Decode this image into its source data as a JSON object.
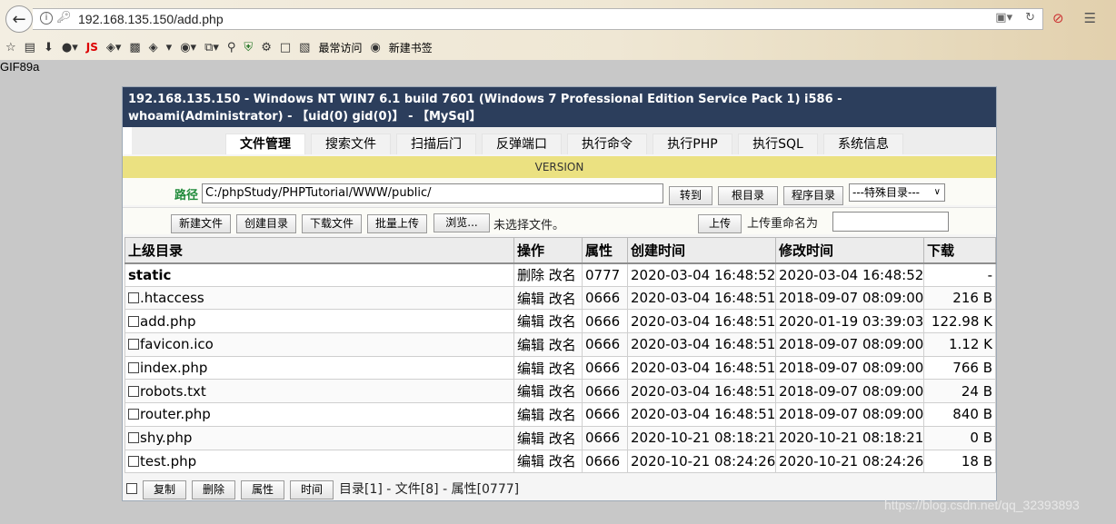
{
  "browser": {
    "url": "192.168.135.150/add.php",
    "bookmarks": {
      "js_label": "JS",
      "most_visited": "最常访问",
      "new_bookmark": "新建书签"
    }
  },
  "page_top_text": "GIF89a",
  "shell": {
    "header_text": "192.168.135.150 - Windows NT WIN7 6.1 build 7601 (Windows 7 Professional Edition Service Pack 1) i586 - whoami(Administrator) - 【uid(0) gid(0)】 - 【MySql】",
    "tabs": [
      {
        "label": "文件管理",
        "active": true
      },
      {
        "label": "搜索文件",
        "active": false
      },
      {
        "label": "扫描后门",
        "active": false
      },
      {
        "label": "反弹端口",
        "active": false
      },
      {
        "label": "执行命令",
        "active": false
      },
      {
        "label": "执行PHP",
        "active": false
      },
      {
        "label": "执行SQL",
        "active": false
      },
      {
        "label": "系统信息",
        "active": false
      }
    ],
    "version": "VERSION",
    "path": {
      "label": "路径",
      "value": "C:/phpStudy/PHPTutorial/WWW/public/",
      "goto_button": "转到",
      "root_button": "根目录",
      "program_button": "程序目录",
      "special_select": "---特殊目录---"
    },
    "upload": {
      "new_file": "新建文件",
      "create_dir": "创建目录",
      "download_file": "下载文件",
      "batch_upload": "批量上传",
      "browse": "浏览...",
      "no_file": "未选择文件。",
      "upload_button": "上传",
      "rename_label": "上传重命名为",
      "rename_value": ""
    },
    "table": {
      "columns": [
        "上级目录",
        "操作",
        "属性",
        "创建时间",
        "修改时间",
        "下载"
      ],
      "rows": [
        {
          "name": "static",
          "ops": "删除 改名",
          "attr": "0777",
          "created": "2020-03-04 16:48:52",
          "modified": "2020-03-04 16:48:52",
          "size": "-",
          "is_dir": true
        },
        {
          "name": ".htaccess",
          "ops": "编辑 改名",
          "attr": "0666",
          "created": "2020-03-04 16:48:51",
          "modified": "2018-09-07 08:09:00",
          "size": "216 B",
          "is_dir": false
        },
        {
          "name": "add.php",
          "ops": "编辑 改名",
          "attr": "0666",
          "created": "2020-03-04 16:48:51",
          "modified": "2020-01-19 03:39:03",
          "size": "122.98 K",
          "is_dir": false
        },
        {
          "name": "favicon.ico",
          "ops": "编辑 改名",
          "attr": "0666",
          "created": "2020-03-04 16:48:51",
          "modified": "2018-09-07 08:09:00",
          "size": "1.12 K",
          "is_dir": false
        },
        {
          "name": "index.php",
          "ops": "编辑 改名",
          "attr": "0666",
          "created": "2020-03-04 16:48:51",
          "modified": "2018-09-07 08:09:00",
          "size": "766 B",
          "is_dir": false
        },
        {
          "name": "robots.txt",
          "ops": "编辑 改名",
          "attr": "0666",
          "created": "2020-03-04 16:48:51",
          "modified": "2018-09-07 08:09:00",
          "size": "24 B",
          "is_dir": false
        },
        {
          "name": "router.php",
          "ops": "编辑 改名",
          "attr": "0666",
          "created": "2020-03-04 16:48:51",
          "modified": "2018-09-07 08:09:00",
          "size": "840 B",
          "is_dir": false
        },
        {
          "name": "shy.php",
          "ops": "编辑 改名",
          "attr": "0666",
          "created": "2020-10-21 08:18:21",
          "modified": "2020-10-21 08:18:21",
          "size": "0 B",
          "is_dir": false
        },
        {
          "name": "test.php",
          "ops": "编辑 改名",
          "attr": "0666",
          "created": "2020-10-21 08:24:26",
          "modified": "2020-10-21 08:24:26",
          "size": "18 B",
          "is_dir": false
        }
      ]
    },
    "bottom": {
      "copy": "复制",
      "delete": "删除",
      "attr": "属性",
      "time": "时间",
      "summary": "目录[1] - 文件[8] - 属性[0777]"
    }
  },
  "watermark": "https://blog.csdn.net/qq_32393893"
}
